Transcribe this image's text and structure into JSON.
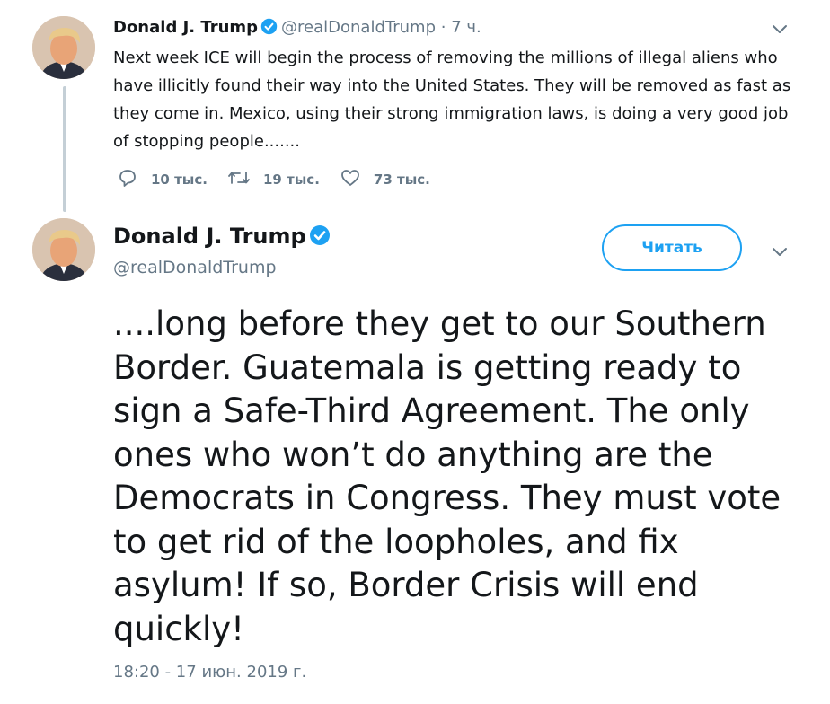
{
  "tweet1": {
    "author_name": "Donald J. Trump",
    "author_handle": "@realDonaldTrump",
    "separator": "·",
    "time_ago": "7 ч.",
    "text": "Next week ICE will begin the process of removing the millions of illegal aliens who have illicitly found their way into the United States. They will be removed as fast as they come in. Mexico, using their strong immigration laws, is doing a very good job of stopping people.......",
    "replies": "10 тыс.",
    "retweets": "19 тыс.",
    "likes": "73 тыс."
  },
  "tweet2": {
    "author_name": "Donald J. Trump",
    "author_handle": "@realDonaldTrump",
    "follow_label": "Читать",
    "text": "....long before they get to our Southern Border. Guatemala is getting ready to sign a Safe-Third Agreement. The only ones who won’t do anything are the Democrats in Congress. They must vote to get rid of the loopholes, and fix asylum! If so, Border Crisis will end quickly!",
    "timestamp": "18:20 - 17 июн. 2019 г."
  },
  "colors": {
    "accent": "#1da1f2",
    "muted_text": "#657786",
    "thread_line": "#c4cfd6"
  },
  "icons": [
    "verified-badge-icon",
    "reply-icon",
    "retweet-icon",
    "like-icon",
    "chevron-down-icon",
    "avatar"
  ]
}
